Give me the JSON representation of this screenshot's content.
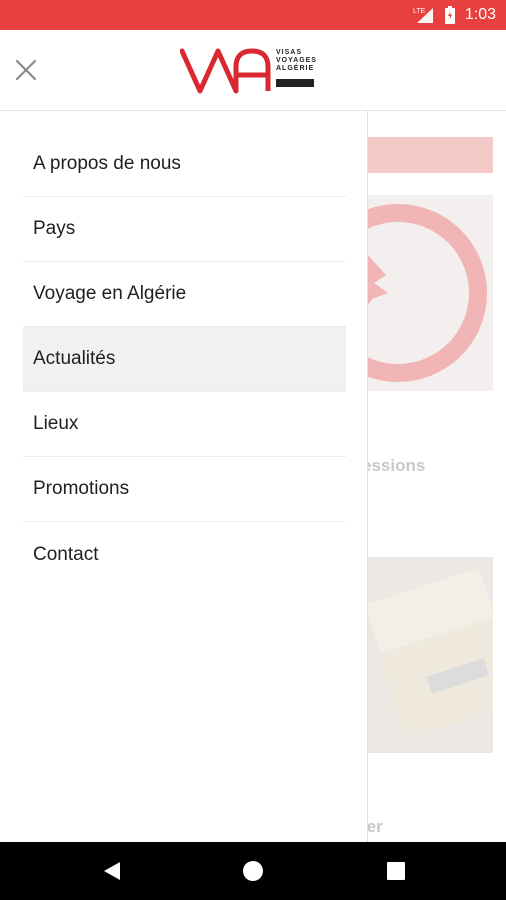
{
  "status_bar": {
    "network": "LTE",
    "time": "1:03",
    "background_color": "#e8403e"
  },
  "header": {
    "close_icon": "close-icon",
    "logo": {
      "mark": "VA",
      "line1": "VISAS",
      "line2": "VOYAGES",
      "line3": "ALGÉRIE",
      "color": "#d9282f"
    }
  },
  "drawer": {
    "items": [
      {
        "label": "A propos de nous",
        "active": false
      },
      {
        "label": "Pays",
        "active": false
      },
      {
        "label": "Voyage en Algérie",
        "active": false
      },
      {
        "label": "Actualités",
        "active": true
      },
      {
        "label": "Lieux",
        "active": false
      },
      {
        "label": "Promotions",
        "active": false
      },
      {
        "label": "Contact",
        "active": false
      }
    ]
  },
  "background_page": {
    "snippet_1": "essions",
    "snippet_2": "ier"
  },
  "nav_bar": {
    "back_icon": "back-triangle-icon",
    "home_icon": "home-circle-icon",
    "recent_icon": "recent-square-icon"
  }
}
